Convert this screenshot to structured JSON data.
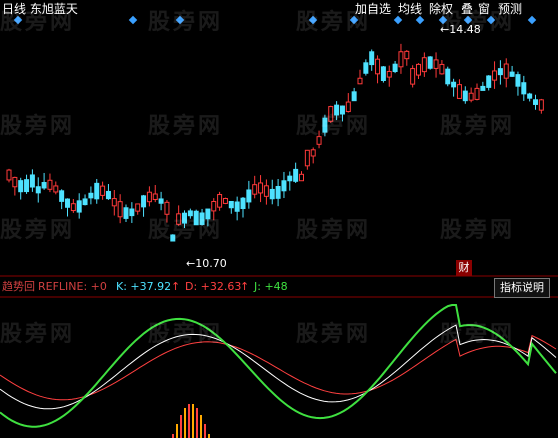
{
  "header": {
    "title": "日线 东旭蓝天",
    "buttons": [
      "加自选",
      "均线",
      "除权",
      "叠",
      "窗",
      "预测"
    ]
  },
  "price": {
    "high_label": "14.48",
    "low_label": "10.70",
    "cai_badge": "财"
  },
  "indicator": {
    "name": "趋势回",
    "refline": "REFLINE: +0",
    "k_label": "K: +37.92",
    "d_label": "D: +32.63",
    "j_label": "J: +48",
    "help_button": "指标说明"
  },
  "watermark": "股旁网",
  "colors": {
    "up": "#ff3a3a",
    "down": "#4ee2ff",
    "k_line": "#ffffff",
    "d_line": "#ff4040",
    "j_line": "#3fe040",
    "diamond": "#3aa0ff"
  }
}
